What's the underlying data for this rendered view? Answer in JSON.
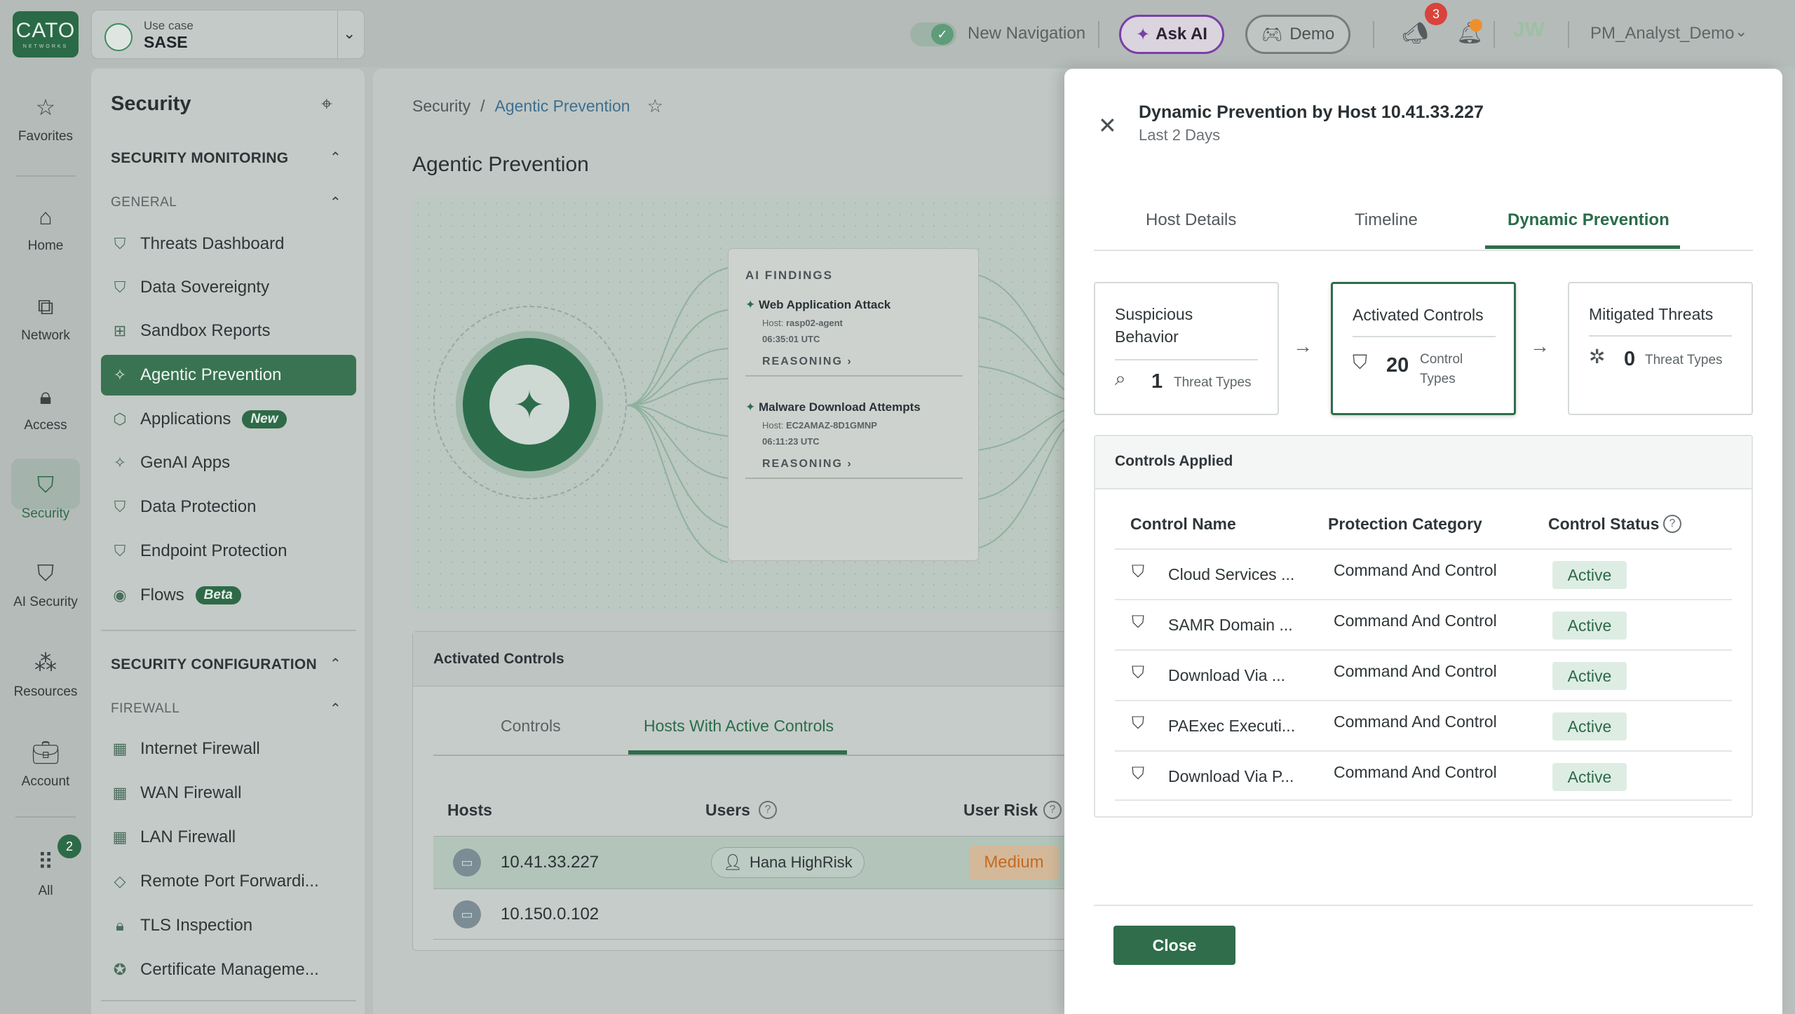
{
  "header": {
    "logo_text": "CATO",
    "logo_sub": "NETWORKS",
    "use_case_label": "Use case",
    "use_case_value": "SASE",
    "new_navigation_label": "New Navigation",
    "ask_ai_label": "Ask AI",
    "demo_label": "Demo",
    "announcements_count": "3",
    "user_initials": "JW",
    "username": "PM_Analyst_Demo",
    "colors": {
      "brand": "#2a6a47",
      "ask_ai_border": "#7a3fa8",
      "badge": "#d8433c"
    }
  },
  "rail": {
    "items": [
      {
        "label": "Favorites",
        "icon": "star-icon"
      },
      {
        "label": "Home",
        "icon": "home-icon"
      },
      {
        "label": "Network",
        "icon": "network-icon"
      },
      {
        "label": "Access",
        "icon": "lock-icon"
      },
      {
        "label": "Security",
        "icon": "shield-icon"
      },
      {
        "label": "AI Security",
        "icon": "ai-shield-icon"
      },
      {
        "label": "Resources",
        "icon": "resources-icon"
      },
      {
        "label": "Account",
        "icon": "briefcase-icon"
      },
      {
        "label": "All",
        "icon": "grid-icon"
      }
    ],
    "all_badge": "2"
  },
  "sidebar": {
    "title": "Security",
    "sections": {
      "monitoring": "SECURITY MONITORING",
      "general": "GENERAL",
      "configuration": "SECURITY CONFIGURATION",
      "firewall": "FIREWALL"
    },
    "general_items": [
      {
        "label": "Threats Dashboard",
        "icon": "shield-icon"
      },
      {
        "label": "Data Sovereignty",
        "icon": "shield-icon"
      },
      {
        "label": "Sandbox Reports",
        "icon": "grid-icon"
      },
      {
        "label": "Agentic Prevention",
        "icon": "sparkle-icon"
      },
      {
        "label": "Applications",
        "icon": "cube-icon",
        "badge": "New"
      },
      {
        "label": "GenAI Apps",
        "icon": "sparkle-icon"
      },
      {
        "label": "Data Protection",
        "icon": "shield-icon"
      },
      {
        "label": "Endpoint Protection",
        "icon": "shield-icon"
      },
      {
        "label": "Flows",
        "icon": "target-icon",
        "badge": "Beta"
      }
    ],
    "firewall_items": [
      {
        "label": "Internet Firewall",
        "icon": "firewall-icon"
      },
      {
        "label": "WAN Firewall",
        "icon": "firewall-icon"
      },
      {
        "label": "LAN Firewall",
        "icon": "firewall-icon"
      },
      {
        "label": "Remote Port Forwardi...",
        "icon": "diamond-icon"
      },
      {
        "label": "TLS Inspection",
        "icon": "lock-icon"
      },
      {
        "label": "Certificate Manageme...",
        "icon": "badge-check-icon"
      }
    ]
  },
  "main": {
    "breadcrumb": {
      "root": "Security",
      "separator": "/",
      "current": "Agentic Prevention"
    },
    "title": "Agentic Prevention",
    "findings": {
      "title": "AI FINDINGS",
      "items": [
        {
          "title": "Web Application Attack",
          "host_label": "Host:",
          "host": "rasp02-agent",
          "time": "06:35:01 UTC",
          "reasoning": "REASONING ›"
        },
        {
          "title": "Malware Download Attempts",
          "host_label": "Host:",
          "host": "EC2AMAZ-8D1GMNP",
          "time": "06:11:23 UTC",
          "reasoning": "REASONING ›"
        }
      ]
    },
    "activated_controls": {
      "title": "Activated Controls",
      "tabs": [
        "Controls",
        "Hosts With Active Controls"
      ],
      "columns": [
        "Hosts",
        "Users",
        "User Risk"
      ],
      "rows": [
        {
          "host": "10.41.33.227",
          "user": "Hana HighRisk",
          "risk": "Medium"
        },
        {
          "host": "10.150.0.102",
          "user": "",
          "risk": ""
        }
      ]
    }
  },
  "drawer": {
    "title": "Dynamic Prevention by Host 10.41.33.227",
    "subtitle": "Last 2 Days",
    "tabs": [
      "Host Details",
      "Timeline",
      "Dynamic Prevention"
    ],
    "stages": [
      {
        "label": "Suspicious Behavior",
        "count": "1",
        "unit": "Threat Types",
        "icon": "search-threat-icon"
      },
      {
        "label": "Activated Controls",
        "count": "20",
        "unit": "Control Types",
        "icon": "shield-icon"
      },
      {
        "label": "Mitigated Threats",
        "count": "0",
        "unit": "Threat Types",
        "icon": "bug-icon"
      }
    ],
    "controls_applied": {
      "title": "Controls Applied",
      "columns": [
        "Control Name",
        "Protection Category",
        "Control Status"
      ],
      "rows": [
        {
          "name": "Cloud Services ...",
          "category": "Command And Control",
          "status": "Active"
        },
        {
          "name": "SAMR Domain ...",
          "category": "Command And Control",
          "status": "Active"
        },
        {
          "name": "Download Via ...",
          "category": "Command And Control",
          "status": "Active"
        },
        {
          "name": "PAExec Executi...",
          "category": "Command And Control",
          "status": "Active"
        },
        {
          "name": "Download Via P...",
          "category": "Command And Control",
          "status": "Active"
        }
      ]
    },
    "close_label": "Close"
  }
}
